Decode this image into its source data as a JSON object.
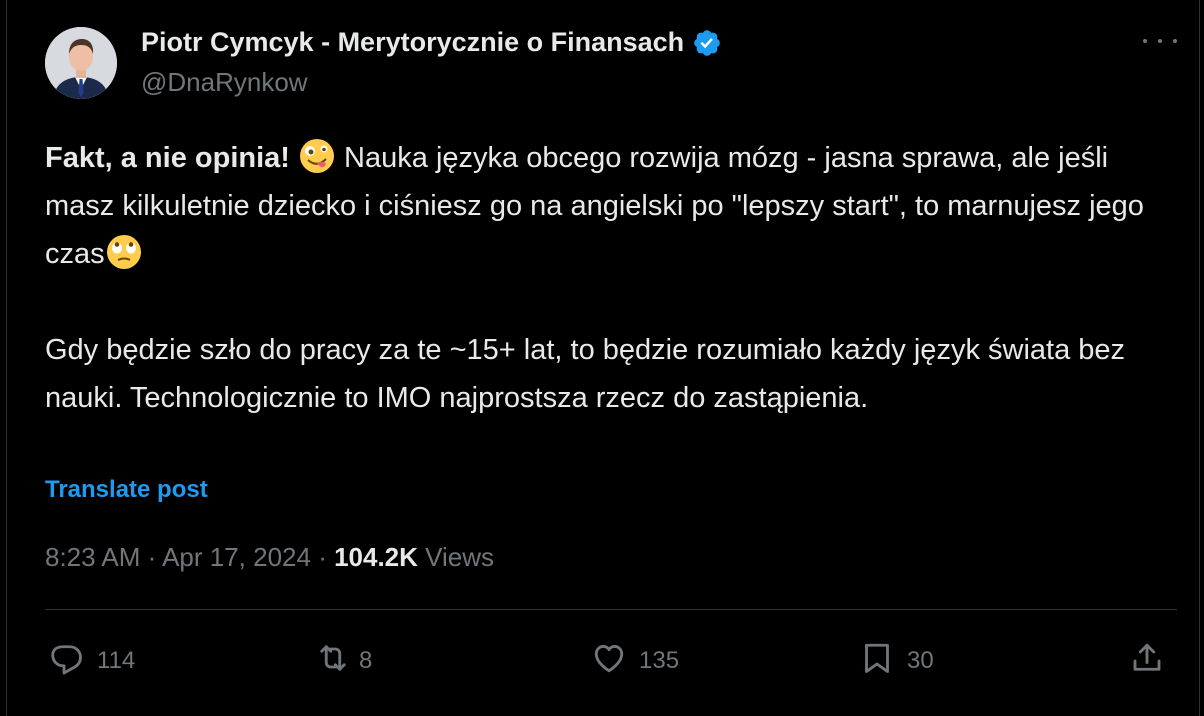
{
  "author": {
    "name": "Piotr Cymcyk - Merytorycznie o Finansach",
    "handle": "@DnaRynkow",
    "verified_color": "#1d9bf0"
  },
  "tweet": {
    "bold_lead": "Fakt, a nie opinia!",
    "emoji_1": "zany-face-emoji",
    "line_1": " Nauka języka obcego rozwija mózg - jasna sprawa, ale jeśli masz kilkuletnie dziecko i ciśniesz go na angielski po \"lepszy start\", to marnujesz jego czas",
    "emoji_2": "face-with-rolling-eyes-emoji",
    "paragraph_2": "Gdy będzie szło do pracy za te ~15+ lat, to będzie rozumiało każdy język świata bez nauki. Technologicznie  to IMO najprostsza rzecz do zastąpienia."
  },
  "translate_label": "Translate post",
  "meta": {
    "time": "8:23 AM",
    "separator": " · ",
    "date": "Apr 17, 2024",
    "views_count": "104.2K",
    "views_label": " Views"
  },
  "actions": {
    "replies": "114",
    "reposts": "8",
    "likes": "135",
    "bookmarks": "30"
  },
  "colors": {
    "background": "#000000",
    "text": "#e7e9ea",
    "muted": "#71767b",
    "accent": "#1d9bf0",
    "divider": "#2f3336"
  }
}
